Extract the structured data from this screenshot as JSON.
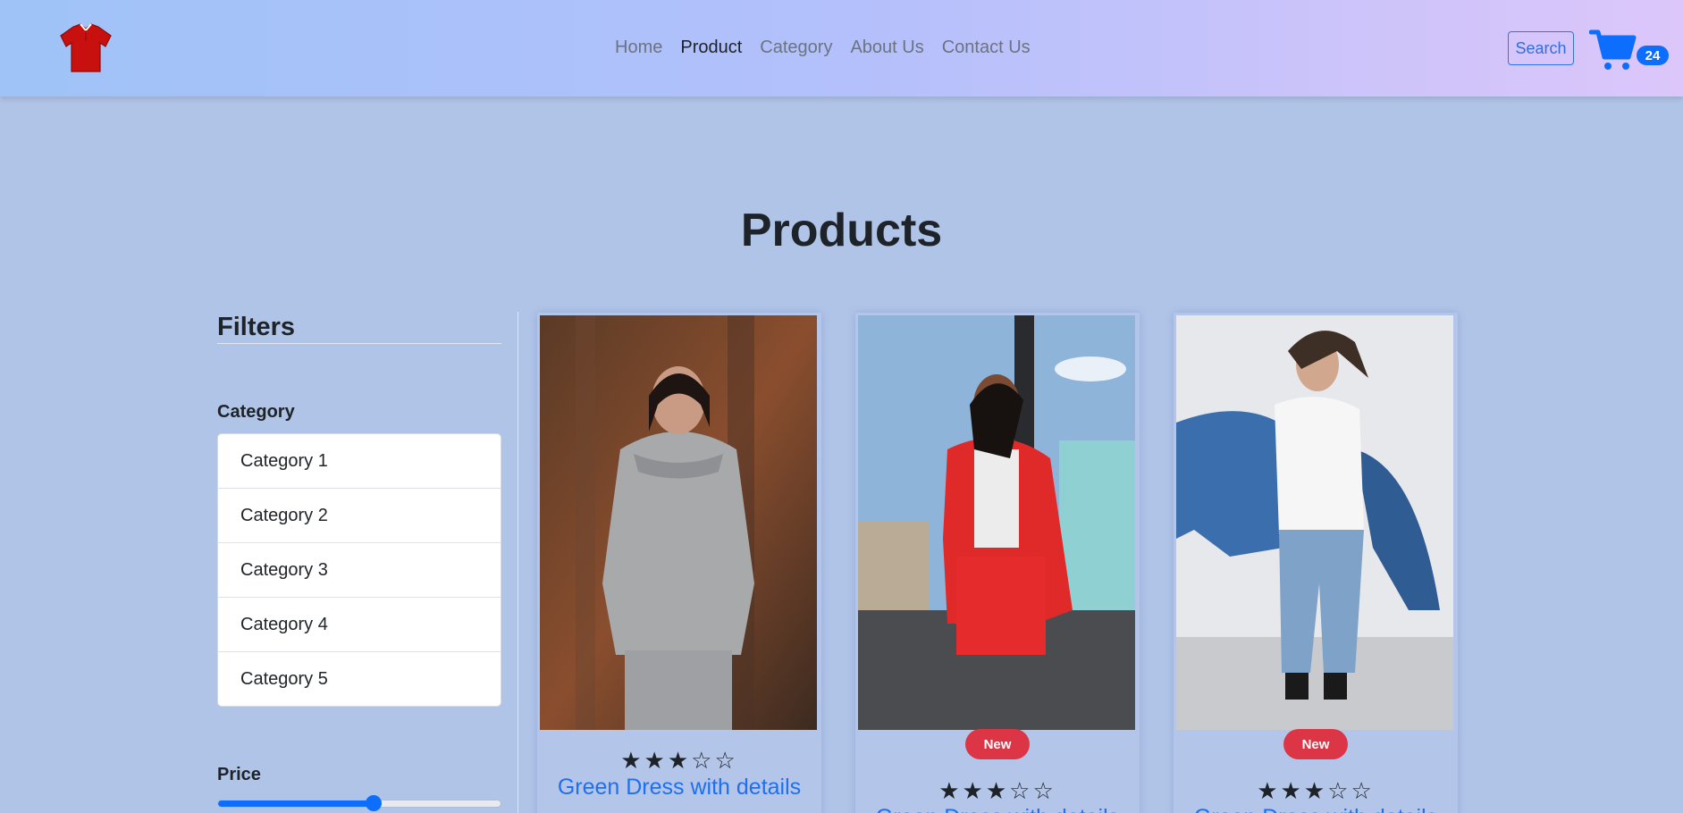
{
  "navbar": {
    "links": [
      {
        "label": "Home",
        "active": false
      },
      {
        "label": "Product",
        "active": true
      },
      {
        "label": "Category",
        "active": false
      },
      {
        "label": "About Us",
        "active": false
      },
      {
        "label": "Contact Us",
        "active": false
      }
    ],
    "search_label": "Search",
    "cart_count": "24",
    "logo_icon": "red-shirt-icon",
    "cart_icon": "shopping-cart-icon"
  },
  "page": {
    "title": "Products"
  },
  "filters": {
    "title": "Filters",
    "category_title": "Category",
    "categories": [
      "Category 1",
      "Category 2",
      "Category 3",
      "Category 4",
      "Category 5"
    ],
    "price_title": "Price",
    "price_slider_fraction": 0.55
  },
  "products": [
    {
      "title": "Green Dress with details",
      "rating": 3,
      "max_rating": 5,
      "badge": ""
    },
    {
      "title": "Green Dress with details",
      "rating": 3,
      "max_rating": 5,
      "badge": "New"
    },
    {
      "title": "Green Dress with details",
      "rating": 3,
      "max_rating": 5,
      "badge": "New"
    }
  ],
  "colors": {
    "accent": "#0d6efd",
    "badge_red": "#dc3545",
    "title_blue": "#1f6ff0",
    "background": "#b0c4e8"
  }
}
